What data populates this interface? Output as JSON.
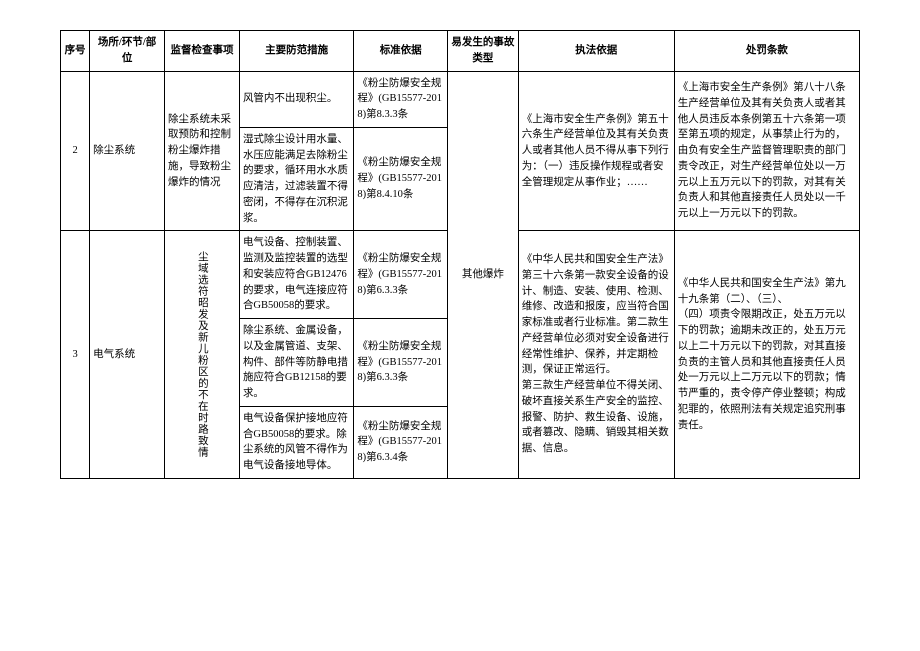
{
  "headers": {
    "seq": "序号",
    "place": "场所/环节/部位",
    "inspect": "监督检查事项",
    "measure": "主要防范措施",
    "basis": "标准依据",
    "accident": "易发生的事故类型",
    "law": "执法依据",
    "penalty": "处罚条款"
  },
  "row2": {
    "seq": "2",
    "place": "除尘系统",
    "inspect": "除尘系统未采取预防和控制粉尘爆炸措施，导致粉尘爆炸的情况",
    "measure1": "风管内不出现积尘。",
    "basis1": "《粉尘防爆安全规程》(GB15577-2018)第8.3.3条",
    "measure2": "湿式除尘设计用水量、水压应能满足去除粉尘的要求，循环用水水质应清洁，过滤装置不得密闭，不得存在沉积泥浆。",
    "basis2": "《粉尘防爆安全规程》(GB15577-2018)第8.4.10条",
    "law": "《上海市安全生产条例》第五十六条生产经营单位及其有关负责人或者其他人员不得从事下列行为：（一）违反操作规程或者安全管理规定从事作业；……",
    "penalty": "《上海市安全生产条例》第八十八条生产经营单位及其有关负责人或者其他人员违反本条例第五十六条第一项至第五项的规定，从事禁止行为的，由负有安全生产监督管理职责的部门责令改正，对生产经营单位处以一万元以上五万元以下的罚款，对其有关负责人和其他直接责任人员处以一千元以上一万元以下的罚款。"
  },
  "row3": {
    "seq": "3",
    "place": "电气系统",
    "inspect": "尘域选符昭发及新儿粉区的不在时路致情",
    "measure1": "电气设备、控制装置、监测及监控装置的选型和安装应符合GB12476的要求，电气连接应符合GB50058的要求。",
    "basis1": "《粉尘防爆安全规程》(GB15577-2018)第6.3.3条",
    "measure2": "除尘系统、金属设备，以及金属管道、支架、构件、部件等防静电措施应符合GB12158的要求。",
    "basis2": "《粉尘防爆安全规程》(GB15577-2018)第6.3.3条",
    "measure3": "电气设备保护接地应符合GB50058的要求。除尘系统的风管不得作为电气设备接地导体。",
    "basis3": "《粉尘防爆安全规程》(GB15577-2018)第6.3.4条",
    "accident": "其他爆炸",
    "law": "《中华人民共和国安全生产法》第三十六条第一款安全设备的设计、制造、安装、使用、检测、维修、改造和报废，应当符合国家标准或者行业标准。第二款生产经营单位必须对安全设备进行经常性维护、保养，并定期检测，保证正常运行。\n第三款生产经营单位不得关闭、破坏直接关系生产安全的监控、报警、防护、救生设备、设施，或者篡改、隐瞒、销毁其相关数据、信息。",
    "penalty": "《中华人民共和国安全生产法》第九十九条第（二）、（三）、\n（四）项责令限期改正，处五万元以下的罚款；逾期未改正的，处五万元以上二十万元以下的罚款，对其直接负责的主管人员和其他直接责任人员处一万元以上二万元以下的罚款；情节严重的，责令停产停业整顿；构成犯罪的，依照刑法有关规定追究刑事责任。"
  }
}
